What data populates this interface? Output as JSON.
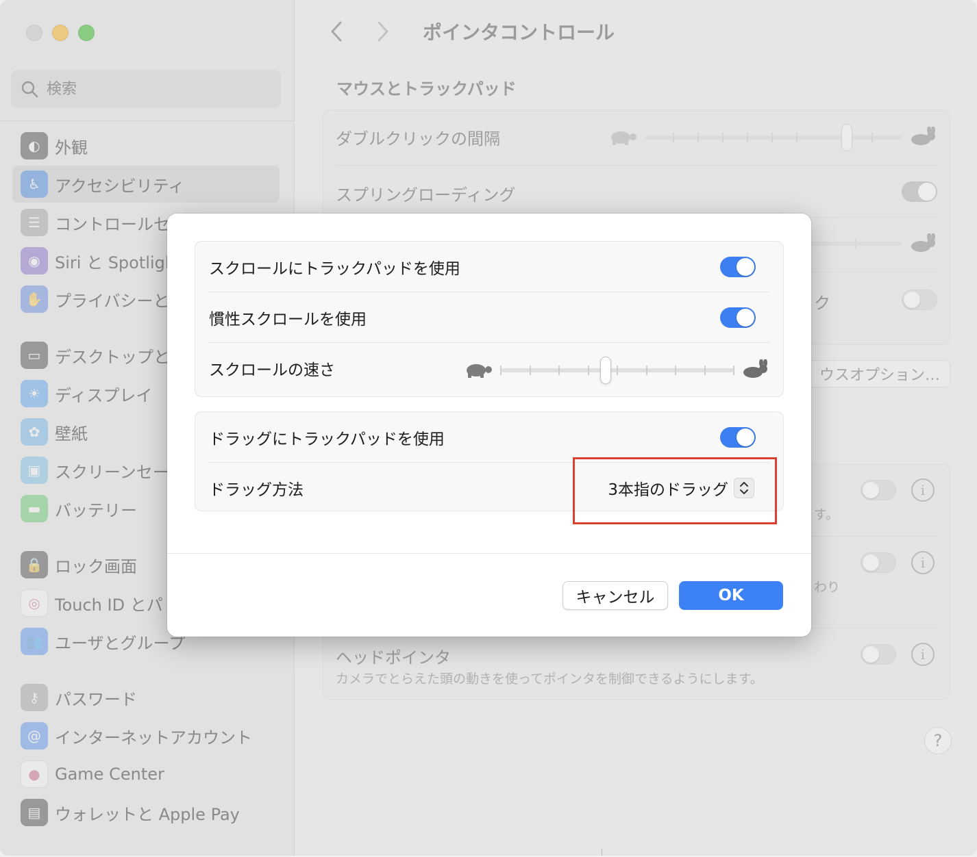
{
  "window": {
    "title": "ポインタコントロール"
  },
  "search": {
    "placeholder": "検索"
  },
  "sidebar": {
    "items": [
      {
        "label": "外観",
        "icon": "appearance-icon",
        "color": "#1c1c1e"
      },
      {
        "label": "アクセシビリティ",
        "icon": "accessibility-icon",
        "color": "#1a73e8",
        "selected": true
      },
      {
        "label": "コントロールセ",
        "icon": "control-center-icon",
        "color": "#8e8e93"
      },
      {
        "label": "Siri と Spotligh",
        "icon": "siri-icon",
        "color": "#6b46c1"
      },
      {
        "label": "プライバシーと",
        "icon": "hand-icon",
        "color": "#3d6fe0"
      },
      {
        "label": "デスクトップと",
        "icon": "desktop-icon",
        "color": "#1c1c1e"
      },
      {
        "label": "ディスプレイ",
        "icon": "display-icon",
        "color": "#2d8cf0"
      },
      {
        "label": "壁紙",
        "icon": "wallpaper-icon",
        "color": "#4aa6e8"
      },
      {
        "label": "スクリーンセー",
        "icon": "screensaver-icon",
        "color": "#5ab2e6"
      },
      {
        "label": "バッテリー",
        "icon": "battery-icon",
        "color": "#3dbf4f"
      },
      {
        "label": "ロック画面",
        "icon": "lock-icon",
        "color": "#1c1c1e"
      },
      {
        "label": "Touch ID とパ",
        "icon": "fingerprint-icon",
        "color": "#ffffff"
      },
      {
        "label": "ユーザとグループ",
        "icon": "users-icon",
        "color": "#2f7bf0"
      },
      {
        "label": "パスワード",
        "icon": "key-icon",
        "color": "#8e8e93"
      },
      {
        "label": "インターネットアカウント",
        "icon": "at-icon",
        "color": "#2f7bf0"
      },
      {
        "label": "Game Center",
        "icon": "game-center-icon",
        "color": "#ffffff"
      },
      {
        "label": "ウォレットと Apple Pay",
        "icon": "wallet-icon",
        "color": "#1c1c1e"
      }
    ]
  },
  "main": {
    "section_title": "マウスとトラックパッド",
    "double_click_label": "ダブルクリックの間隔",
    "spring_loading_label": "スプリングローディング",
    "partial_label_ku": "ク",
    "mouse_options_button": "ウスオプション…",
    "partial_text_su": "す。",
    "partial_text_wari": "わり",
    "head_pointer_label": "ヘッドポインタ",
    "head_pointer_desc": "カメラでとらえた頭の動きを使ってポインタを制御できるようにします。",
    "help_label": "?",
    "info_label": "i"
  },
  "dialog": {
    "scroll_group": {
      "use_trackpad_scroll": {
        "label": "スクロールにトラックパッドを使用",
        "on": true
      },
      "inertia_scroll": {
        "label": "慣性スクロールを使用",
        "on": true
      },
      "scroll_speed": {
        "label": "スクロールの速さ",
        "value_fraction": 0.45,
        "ticks": 9
      }
    },
    "drag_group": {
      "use_trackpad_drag": {
        "label": "ドラッグにトラックパッドを使用",
        "on": true
      },
      "drag_method": {
        "label": "ドラッグ方法",
        "value": "3本指のドラッグ"
      }
    },
    "buttons": {
      "cancel": "キャンセル",
      "ok": "OK"
    }
  },
  "colors": {
    "accent": "#3c82f6",
    "highlight": "#d9402f"
  }
}
